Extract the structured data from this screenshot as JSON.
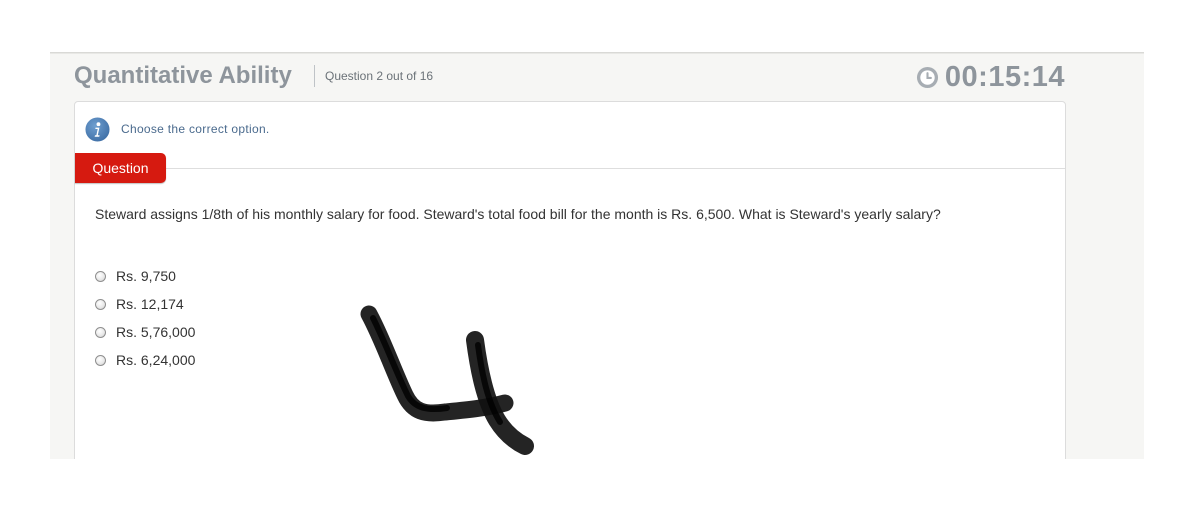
{
  "header": {
    "section_title": "Quantitative Ability",
    "question_counter": "Question 2 out of 16",
    "timer": "00:15:14",
    "timer_icon": "clock-icon"
  },
  "instruction": {
    "icon": "info-icon",
    "text": "Choose the correct option."
  },
  "question_tab": {
    "label": "Question",
    "color": "#d61a10"
  },
  "question": {
    "text": "Steward assigns 1/8th of his monthly salary for food. Steward's total food bill for the month is Rs. 6,500. What is Steward's yearly salary?"
  },
  "options": [
    {
      "label": "Rs. 9,750",
      "selected": false
    },
    {
      "label": "Rs. 12,174",
      "selected": false
    },
    {
      "label": "Rs. 5,76,000",
      "selected": false
    },
    {
      "label": "Rs. 6,24,000",
      "selected": false
    }
  ],
  "overlay": {
    "description": "handwritten-mark",
    "color": "#111111"
  }
}
